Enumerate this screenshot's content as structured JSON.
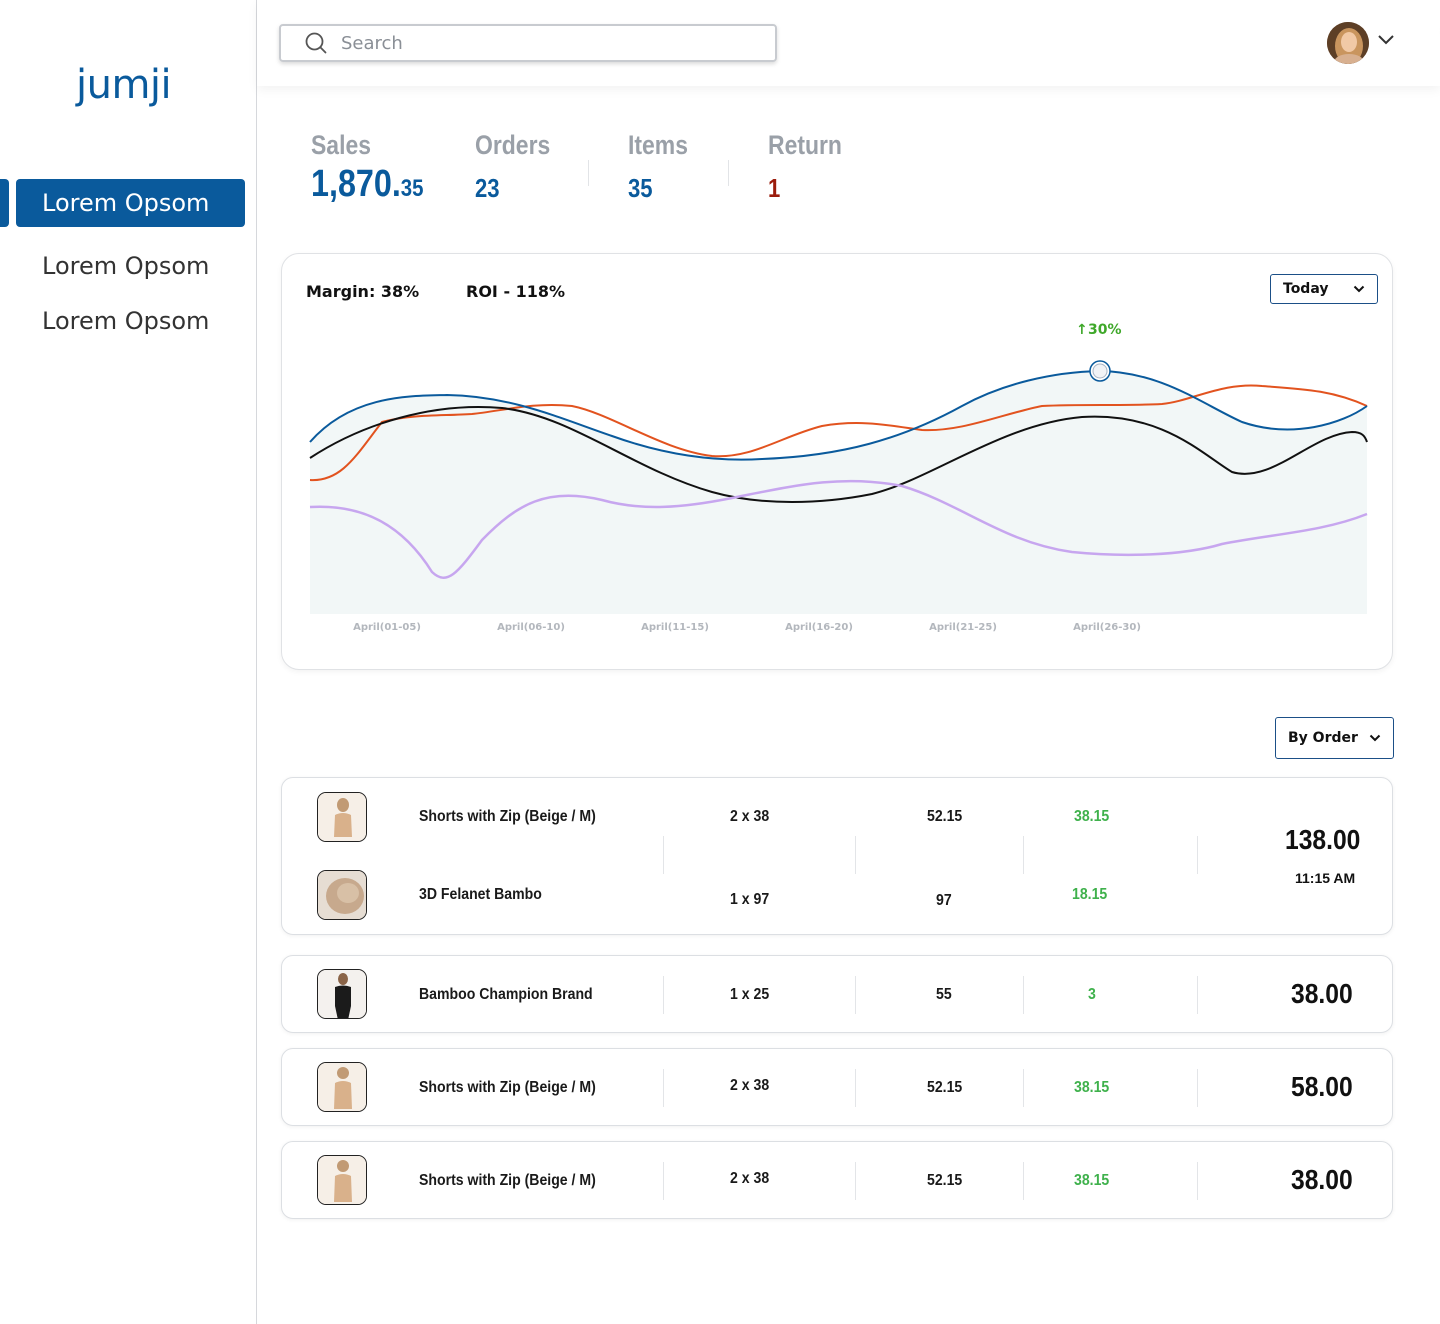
{
  "app": {
    "logo": "jumji"
  },
  "sidebar": {
    "items": [
      {
        "label": "Lorem Opsom",
        "active": true
      },
      {
        "label": "Lorem Opsom",
        "active": false
      },
      {
        "label": "Lorem Opsom",
        "active": false
      }
    ]
  },
  "topbar": {
    "search_placeholder": "Search",
    "avatar_icon": "user-avatar",
    "menu_icon": "chevron-down-icon"
  },
  "stats": {
    "sales": {
      "label": "Sales",
      "value_main": "1,870.",
      "value_cents": "35"
    },
    "orders": {
      "label": "Orders",
      "value": "23"
    },
    "items": {
      "label": "Items",
      "value": "35"
    },
    "return": {
      "label": "Return",
      "value": "1"
    }
  },
  "chart_card": {
    "margin": "Margin: 38%",
    "roi": "ROI - 118%",
    "period_select": "Today",
    "highlight_label": "30%"
  },
  "chart_data": {
    "type": "line",
    "title": "",
    "xlabel": "",
    "ylabel": "",
    "categories": [
      "April(01-05)",
      "April(06-10)",
      "April(11-15)",
      "April(16-20)",
      "April(21-25)",
      "April(26-30)"
    ],
    "highlight": {
      "category": "April(26-30)",
      "change": "+30%"
    },
    "grid": false,
    "colors": {
      "series1": "#0a5a9c",
      "series2": "#e2531f",
      "series3": "#111111",
      "series4": "#c7a6ef",
      "fill": "#eef3f3"
    }
  },
  "orders": {
    "sort_select": "By Order",
    "list": [
      {
        "lines": [
          {
            "name": "Shorts with Zip (Beige / M)",
            "qty": "2 x 38",
            "price": "52.15",
            "profit": "38.15"
          },
          {
            "name": "3D Felanet Bambo",
            "qty": "1 x 97",
            "price": "97",
            "profit": "18.15"
          }
        ],
        "total": "138.00",
        "time": "11:15 AM"
      },
      {
        "lines": [
          {
            "name": "Bamboo Champion Brand",
            "qty": "1 x 25",
            "price": "55",
            "profit": "3"
          }
        ],
        "total": "38.00"
      },
      {
        "lines": [
          {
            "name": "Shorts with Zip (Beige / M)",
            "qty": "2 x 38",
            "price": "52.15",
            "profit": "38.15"
          }
        ],
        "total": "58.00"
      },
      {
        "lines": [
          {
            "name": "Shorts with Zip (Beige / M)",
            "qty": "2 x 38",
            "price": "52.15",
            "profit": "38.15"
          }
        ],
        "total": "38.00"
      }
    ]
  }
}
